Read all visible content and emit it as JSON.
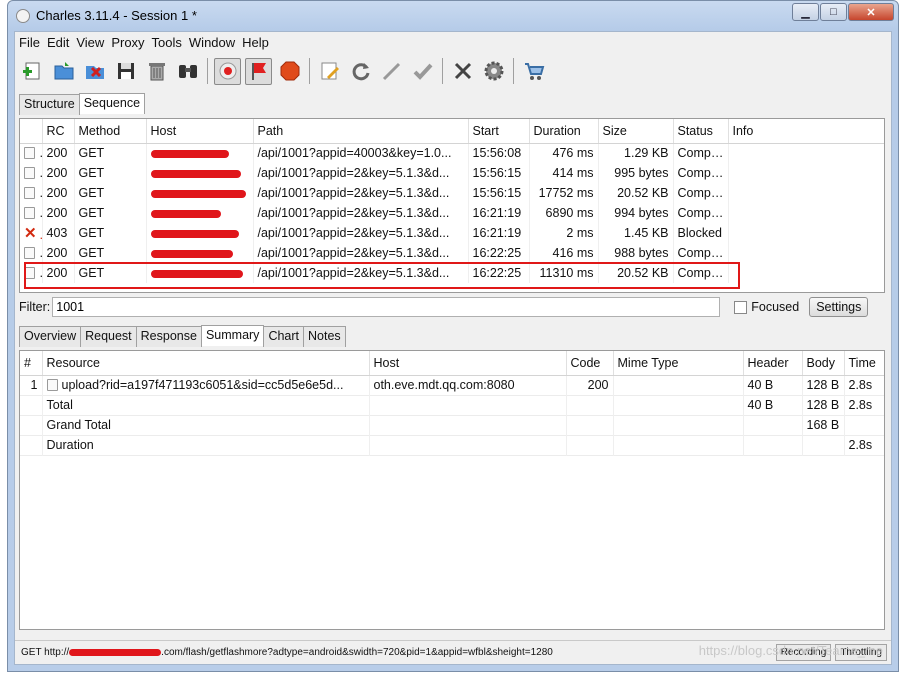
{
  "window": {
    "title": "Charles 3.11.4 - Session 1 *"
  },
  "menu": [
    "File",
    "Edit",
    "View",
    "Proxy",
    "Tools",
    "Window",
    "Help"
  ],
  "tabs_top": [
    "Structure",
    "Sequence"
  ],
  "sequence": {
    "columns": [
      "RC",
      "Method",
      "Host",
      "Path",
      "Start",
      "Duration",
      "Size",
      "Status",
      "Info"
    ],
    "rows": [
      {
        "icon": "file",
        "rc": "200",
        "method": "GET",
        "path": "/api/1001?appid=40003&key=1.0...",
        "start": "15:56:08",
        "duration": "476 ms",
        "size": "1.29 KB",
        "status": "Compl..."
      },
      {
        "icon": "file",
        "rc": "200",
        "method": "GET",
        "path": "/api/1001?appid=2&key=5.1.3&d...",
        "start": "15:56:15",
        "duration": "414 ms",
        "size": "995 bytes",
        "status": "Compl..."
      },
      {
        "icon": "file",
        "rc": "200",
        "method": "GET",
        "path": "/api/1001?appid=2&key=5.1.3&d...",
        "start": "15:56:15",
        "duration": "17752 ms",
        "size": "20.52 KB",
        "status": "Compl..."
      },
      {
        "icon": "file",
        "rc": "200",
        "method": "GET",
        "path": "/api/1001?appid=2&key=5.1.3&d...",
        "start": "16:21:19",
        "duration": "6890 ms",
        "size": "994 bytes",
        "status": "Compl..."
      },
      {
        "icon": "blocked",
        "rc": "403",
        "method": "GET",
        "path": "/api/1001?appid=2&key=5.1.3&d...",
        "start": "16:21:19",
        "duration": "2 ms",
        "size": "1.45 KB",
        "status": "Blocked"
      },
      {
        "icon": "file",
        "rc": "200",
        "method": "GET",
        "path": "/api/1001?appid=2&key=5.1.3&d...",
        "start": "16:22:25",
        "duration": "416 ms",
        "size": "988 bytes",
        "status": "Compl..."
      },
      {
        "icon": "file",
        "rc": "200",
        "method": "GET",
        "path": "/api/1001?appid=2&key=5.1.3&d...",
        "start": "16:22:25",
        "duration": "11310 ms",
        "size": "20.52 KB",
        "status": "Compl..."
      }
    ]
  },
  "filter": {
    "label": "Filter:",
    "value": "1001",
    "focused_label": "Focused",
    "settings_label": "Settings"
  },
  "tabs_bottom": [
    "Overview",
    "Request",
    "Response",
    "Summary",
    "Chart",
    "Notes"
  ],
  "summary": {
    "columns": [
      "#",
      "Resource",
      "Host",
      "Code",
      "Mime Type",
      "Header",
      "Body",
      "Time"
    ],
    "rows": [
      {
        "num": "1",
        "resource": "upload?rid=a197f471193c6051&sid=cc5d5e6e5d...",
        "host": "oth.eve.mdt.qq.com:8080",
        "code": "200",
        "mime": "",
        "header": "40 B",
        "body": "128 B",
        "time": "2.8s"
      },
      {
        "num": "",
        "resource": "Total",
        "host": "",
        "code": "",
        "mime": "",
        "header": "40 B",
        "body": "128 B",
        "time": "2.8s"
      },
      {
        "num": "",
        "resource": "Grand Total",
        "host": "",
        "code": "",
        "mime": "",
        "header": "",
        "body": "168 B",
        "time": ""
      },
      {
        "num": "",
        "resource": "Duration",
        "host": "",
        "code": "",
        "mime": "",
        "header": "",
        "body": "",
        "time": "2.8s"
      }
    ]
  },
  "statusbar": {
    "prefix": "GET http://",
    "suffix": ".com/flash/getflashmore?adtype=android&swidth=720&pid=1&appid=wfbl&sheight=1280",
    "recording": "Recording",
    "throttling": "Throttling"
  },
  "watermark": "https://blog.csdn.net/Teame_me"
}
